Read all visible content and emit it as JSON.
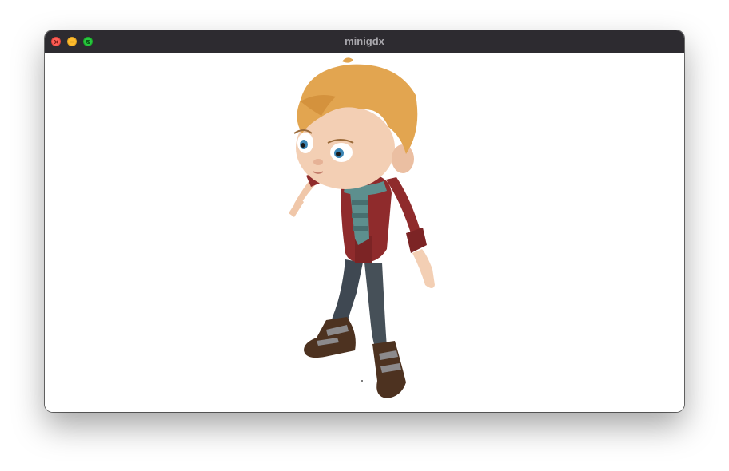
{
  "window": {
    "title": "minigdx",
    "controls": {
      "close": "close-icon",
      "minimize": "minimize-icon",
      "maximize": "maximize-icon"
    }
  },
  "scene": {
    "background": "#ffffff",
    "character_colors": {
      "hair": "#e2a550",
      "skin": "#f3cfb4",
      "jacket": "#8f2b2c",
      "scarf": "#5d8f8e",
      "pants": "#3f4852",
      "boots": "#4d3220",
      "boot_straps": "#8c8a8c"
    }
  }
}
